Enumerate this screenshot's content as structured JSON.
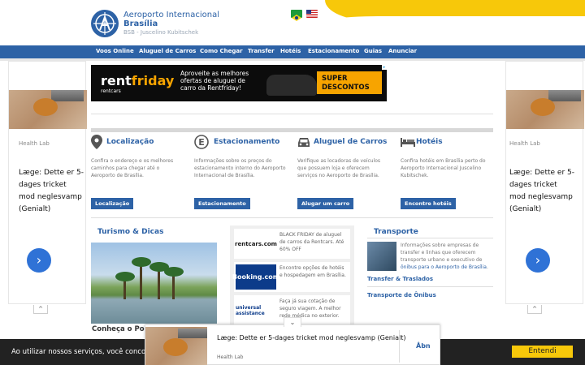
{
  "header": {
    "title": "Aeroporto Internacional",
    "subtitle": "Brasília",
    "tagline": "BSB - Juscelino Kubitschek",
    "flags": [
      "flag-brazil-icon",
      "flag-usa-icon"
    ]
  },
  "nav": {
    "items": [
      "Voos Online",
      "Aluguel de Carros",
      "Como Chegar",
      "Transfer",
      "Hotéis",
      "Estacionamento",
      "Guias",
      "Anunciar"
    ]
  },
  "banner": {
    "logo_main": "rent",
    "logo_accent": "friday",
    "logo_small": "rentcars",
    "text": "Aproveite as melhores ofertas de aluguel de carro da Rentfriday!",
    "badge_line1": "SUPER",
    "badge_line2": "DESCONTOS"
  },
  "side_ad": {
    "brand": "Health Lab",
    "text": "Læge: Dette er 5-dages tricket mod neglesvamp (Genialt)",
    "arrow": "›",
    "tab": "^"
  },
  "features": [
    {
      "icon": "map-pin-icon",
      "title": "Localização",
      "desc": "Confira o endereço e os melhores caminhos para chegar até o Aeroporto de Brasília.",
      "button": "Localização"
    },
    {
      "icon": "parking-icon",
      "title": "Estacionamento",
      "desc": "Informações sobre os preços do estacionamento interno do Aeroporto Internacional de Brasília.",
      "button": "Estacionamento"
    },
    {
      "icon": "car-icon",
      "title": "Aluguel de Carros",
      "desc": "Verifique as locadoras de veículos que possuem loja e oferecem serviços no Aeroporto de Brasília.",
      "button": "Alugar um carro"
    },
    {
      "icon": "bed-icon",
      "title": "Hotéis",
      "desc": "Confira hotéis em Brasília perto do Aeroporto Internacional Juscelino Kubitschek.",
      "button": "Encontre hotéis"
    }
  ],
  "turismo": {
    "title": "Turismo & Dicas",
    "caption": "Conheça o Pontão do Lago Sul"
  },
  "promos": [
    {
      "logo": "rentcars.com",
      "logo_color": "#1b1b1b",
      "logo_bg": "#ffffff",
      "text": "BLACK FRIDAY de aluguel de carros da Rentcars. Até 60% OFF"
    },
    {
      "logo": "Booking.com",
      "logo_color": "#ffffff",
      "logo_bg": "#0c3b8a",
      "text": "Encontre opções de hotéis e hospedagem em Brasília."
    },
    {
      "logo": "universal assistance",
      "logo_color": "#0c3b8a",
      "logo_bg": "#ffffff",
      "text": "Faça já sua cotação de seguro viagem. A melhor rede médica no exterior."
    }
  ],
  "transporte": {
    "title": "Transporte",
    "desc_part1": "Informações sobre empresas de transfer e linhas que oferecem transporte urbano e executivo de ",
    "desc_link": "ônibus para o Aeroporto de Brasília",
    "desc_part2": ".",
    "link1": "Transfer & Traslados",
    "link2": "Transporte de Ônibus"
  },
  "cookie": {
    "text": "Ao utilizar nossos serviços, você concorda com a nossa política de cookies.",
    "button": "Entendi"
  },
  "bottom_ad": {
    "text": "Læge: Dette er 5-dages tricket mod neglesvamp (Genialt)",
    "brand": "Health Lab",
    "open": "Åbn",
    "tab": "⌄"
  }
}
